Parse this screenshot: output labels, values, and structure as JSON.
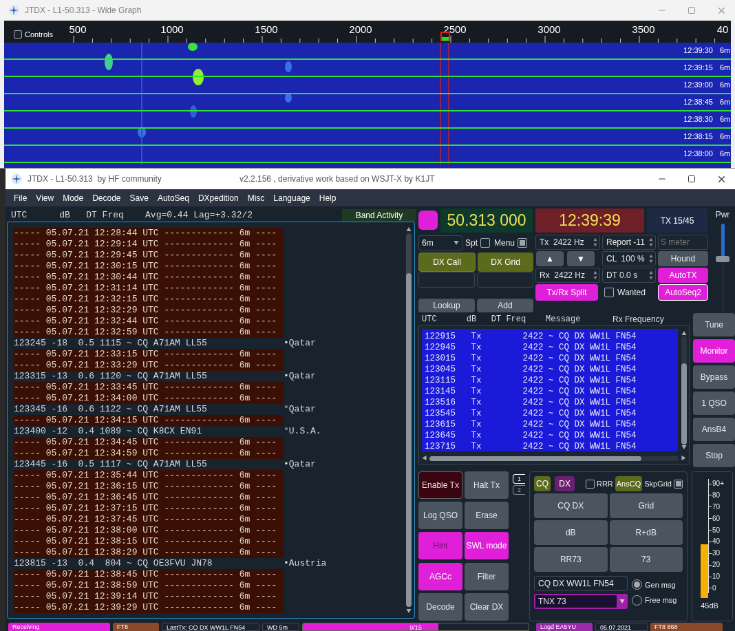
{
  "wide_graph": {
    "title": "JTDX - L1-50.313 - Wide Graph",
    "controls": {
      "label": "Controls",
      "checked": false
    },
    "ruler": [
      "500",
      "1000",
      "1500",
      "2000",
      "2500",
      "3000",
      "3500",
      "40"
    ],
    "rows": [
      {
        "time": "12:39:30",
        "band": "6m"
      },
      {
        "time": "12:39:15",
        "band": "6m"
      },
      {
        "time": "12:39:00",
        "band": "6m"
      },
      {
        "time": "12:38:45",
        "band": "6m"
      },
      {
        "time": "12:38:30",
        "band": "6m"
      },
      {
        "time": "12:38:15",
        "band": "6m"
      },
      {
        "time": "12:38:00",
        "band": "6m"
      }
    ]
  },
  "main": {
    "title": "JTDX - L1-50.313  by HF community",
    "version": "v2.2.156 , derivative work based on WSJT-X by K1JT",
    "menu": [
      "File",
      "View",
      "Mode",
      "Decode",
      "Save",
      "AutoSeq",
      "DXpedition",
      "Misc",
      "Language",
      "Help"
    ]
  },
  "band_activity": {
    "header": "UTC      dB   DT Freq    Avg=0.44 Lag=+3.32/2",
    "tab": "Band Activity",
    "lines": [
      {
        "kind": "separator",
        "text": "----- 05.07.21 12:28:44 UTC ------------- 6m ----"
      },
      {
        "kind": "separator",
        "text": "----- 05.07.21 12:29:14 UTC ------------- 6m ----"
      },
      {
        "kind": "separator",
        "text": "----- 05.07.21 12:29:45 UTC ------------- 6m ----"
      },
      {
        "kind": "separator",
        "text": "----- 05.07.21 12:30:15 UTC ------------- 6m ----"
      },
      {
        "kind": "separator",
        "text": "----- 05.07.21 12:30:44 UTC ------------- 6m ----"
      },
      {
        "kind": "separator",
        "text": "----- 05.07.21 12:31:14 UTC ------------- 6m ----"
      },
      {
        "kind": "separator",
        "text": "----- 05.07.21 12:32:15 UTC ------------- 6m ----"
      },
      {
        "kind": "separator",
        "text": "----- 05.07.21 12:32:29 UTC ------------- 6m ----"
      },
      {
        "kind": "separator",
        "text": "----- 05.07.21 12:32:44 UTC ------------- 6m ----"
      },
      {
        "kind": "separator",
        "text": "----- 05.07.21 12:32:59 UTC ------------- 6m ----"
      },
      {
        "kind": "decode",
        "text": "123245 -18  0.5 1115 ~ CQ A71AM LL55",
        "country": "•Qatar"
      },
      {
        "kind": "separator",
        "text": "----- 05.07.21 12:33:15 UTC ------------- 6m ----"
      },
      {
        "kind": "separator",
        "text": "----- 05.07.21 12:33:29 UTC ------------- 6m ----"
      },
      {
        "kind": "decode",
        "text": "123315 -13  0.6 1120 ~ CQ A71AM LL55",
        "country": "•Qatar"
      },
      {
        "kind": "separator",
        "text": "----- 05.07.21 12:33:45 UTC ------------- 6m ----"
      },
      {
        "kind": "separator",
        "text": "----- 05.07.21 12:34:00 UTC ------------- 6m ----"
      },
      {
        "kind": "decode",
        "text": "123345 -16  0.6 1122 ~ CQ A71AM LL55",
        "country": "°Qatar"
      },
      {
        "kind": "separator",
        "text": "----- 05.07.21 12:34:15 UTC ------------- 6m ----"
      },
      {
        "kind": "decode",
        "text": "123400 -12  0.4 1089 ~ CQ K8CX EN91",
        "country": "°U.S.A."
      },
      {
        "kind": "separator",
        "text": "----- 05.07.21 12:34:45 UTC ------------- 6m ----"
      },
      {
        "kind": "separator",
        "text": "----- 05.07.21 12:34:59 UTC ------------- 6m ----"
      },
      {
        "kind": "decode",
        "text": "123445 -16  0.5 1117 ~ CQ A71AM LL55",
        "country": "•Qatar"
      },
      {
        "kind": "separator",
        "text": "----- 05.07.21 12:35:44 UTC ------------- 6m ----"
      },
      {
        "kind": "separator",
        "text": "----- 05.07.21 12:36:15 UTC ------------- 6m ----"
      },
      {
        "kind": "separator",
        "text": "----- 05.07.21 12:36:45 UTC ------------- 6m ----"
      },
      {
        "kind": "separator",
        "text": "----- 05.07.21 12:37:15 UTC ------------- 6m ----"
      },
      {
        "kind": "separator",
        "text": "----- 05.07.21 12:37:45 UTC ------------- 6m ----"
      },
      {
        "kind": "separator",
        "text": "----- 05.07.21 12:38:00 UTC ------------- 6m ----"
      },
      {
        "kind": "separator",
        "text": "----- 05.07.21 12:38:15 UTC ------------- 6m ----"
      },
      {
        "kind": "separator",
        "text": "----- 05.07.21 12:38:29 UTC ------------- 6m ----"
      },
      {
        "kind": "decode",
        "text": "123815 -13  0.4  804 ~ CQ OE3FVU JN78",
        "country": "•Austria"
      },
      {
        "kind": "separator",
        "text": "----- 05.07.21 12:38:45 UTC ------------- 6m ----"
      },
      {
        "kind": "separator",
        "text": "----- 05.07.21 12:38:59 UTC ------------- 6m ----"
      },
      {
        "kind": "separator",
        "text": "----- 05.07.21 12:39:14 UTC ------------- 6m ----"
      },
      {
        "kind": "separator",
        "text": "----- 05.07.21 12:39:29 UTC ------------- 6m ----"
      }
    ]
  },
  "radio": {
    "dial_frequency": "50.313 000",
    "clock": "12:39:39",
    "tx_period": "TX 15/45",
    "pwr_label": "Pwr",
    "pwr": {
      "level": 0.6
    },
    "band": "6m",
    "spt": {
      "label": "Spt",
      "checked": false
    },
    "menu_toggle": {
      "label": "Menu",
      "checked": true
    },
    "dx_call": "DX Call",
    "dx_grid": "DX Grid",
    "lookup": "Lookup",
    "add": "Add",
    "tx_freq": "Tx  2422 Hz",
    "rx_freq": "Rx  2422 Hz",
    "up": "▲",
    "down": "▼",
    "report": "Report -11",
    "cl": "CL  100 %",
    "dt": "DT 0.0 s",
    "s_meter": {
      "placeholder": "S meter"
    },
    "hound": {
      "label": "Hound",
      "on": false
    },
    "auto_tx": {
      "label": "AutoTX",
      "on": true
    },
    "split": {
      "label": "Tx/Rx Split",
      "on": true
    },
    "wanted": {
      "label": "Wanted",
      "checked": false
    },
    "auto_seq": {
      "label": "AutoSeq2",
      "on": true
    }
  },
  "rx_frequency": {
    "header": "UTC      dB   DT Freq    Message",
    "title": "Rx Frequency",
    "rows": [
      "122915   Tx        2422 ~ CQ DX WW1L FN54",
      "122945   Tx        2422 ~ CQ DX WW1L FN54",
      "123015   Tx        2422 ~ CQ DX WW1L FN54",
      "123045   Tx        2422 ~ CQ DX WW1L FN54",
      "123115   Tx        2422 ~ CQ DX WW1L FN54",
      "123145   Tx        2422 ~ CQ DX WW1L FN54",
      "123516   Tx        2422 ~ CQ DX WW1L FN54",
      "123545   Tx        2422 ~ CQ DX WW1L FN54",
      "123615   Tx        2422 ~ CQ DX WW1L FN54",
      "123645   Tx        2422 ~ CQ DX WW1L FN54",
      "123715   Tx        2422 ~ CQ DX WW1L FN54"
    ]
  },
  "side_buttons": [
    {
      "label": "Tune",
      "on": false
    },
    {
      "label": "Monitor",
      "on": true
    },
    {
      "label": "Bypass",
      "on": false
    },
    {
      "label": "1 QSO",
      "on": false
    },
    {
      "label": "AnsB4",
      "on": false
    },
    {
      "label": "Stop",
      "on": false
    }
  ],
  "action_buttons": [
    {
      "label": "Enable Tx",
      "kind": "tx",
      "on": false,
      "disabled": false
    },
    {
      "label": "Halt Tx",
      "kind": "plain",
      "on": false,
      "disabled": false
    },
    {
      "label": "Log QSO",
      "kind": "plain",
      "on": false,
      "disabled": false
    },
    {
      "label": "Erase",
      "kind": "plain",
      "on": false,
      "disabled": false
    },
    {
      "label": "Hint",
      "kind": "plain",
      "on": true,
      "disabled": true
    },
    {
      "label": "SWL mode",
      "kind": "plain",
      "on": true,
      "disabled": false
    },
    {
      "label": "AGCc",
      "kind": "plain",
      "on": true,
      "disabled": false
    },
    {
      "label": "Filter",
      "kind": "plain",
      "on": false,
      "disabled": false
    },
    {
      "label": "Decode",
      "kind": "plain",
      "on": false,
      "disabled": false
    },
    {
      "label": "Clear DX",
      "kind": "plain",
      "on": false,
      "disabled": false
    }
  ],
  "tx_tabs": [
    {
      "label": "1",
      "selected": true
    },
    {
      "label": "2",
      "selected": false
    }
  ],
  "tx_panel": {
    "cq": "CQ",
    "dx": "DX",
    "rrr": {
      "label": "RRR",
      "checked": false
    },
    "ans_cq": "AnsCQ",
    "skp_grid": {
      "label": "SkpGrid",
      "checked": true
    },
    "messages": [
      "CQ DX",
      "Grid",
      "dB",
      "R+dB",
      "RR73",
      "73"
    ],
    "gen_field": "CQ DX WW1L FN54",
    "free_select": "TNX 73",
    "modes": [
      {
        "label": "Gen msg",
        "selected": true
      },
      {
        "label": "Free msg",
        "selected": false
      }
    ]
  },
  "meter": {
    "scale": [
      "90+",
      "80",
      "70",
      "60",
      "50",
      "40",
      "30",
      "20",
      "10",
      "0"
    ],
    "level": 0.47,
    "reading": "45dB"
  },
  "status_bar": {
    "state": "Receiving",
    "mode": "FT8",
    "last_tx": "LastTx: CQ DX WW1L FN54",
    "wd": "WD 5m",
    "progress": {
      "text": "9/15",
      "level": 0.6
    },
    "logged": "Logd EA5YU",
    "date": "05.07.2021",
    "mode_freq": "FT8  868"
  }
}
